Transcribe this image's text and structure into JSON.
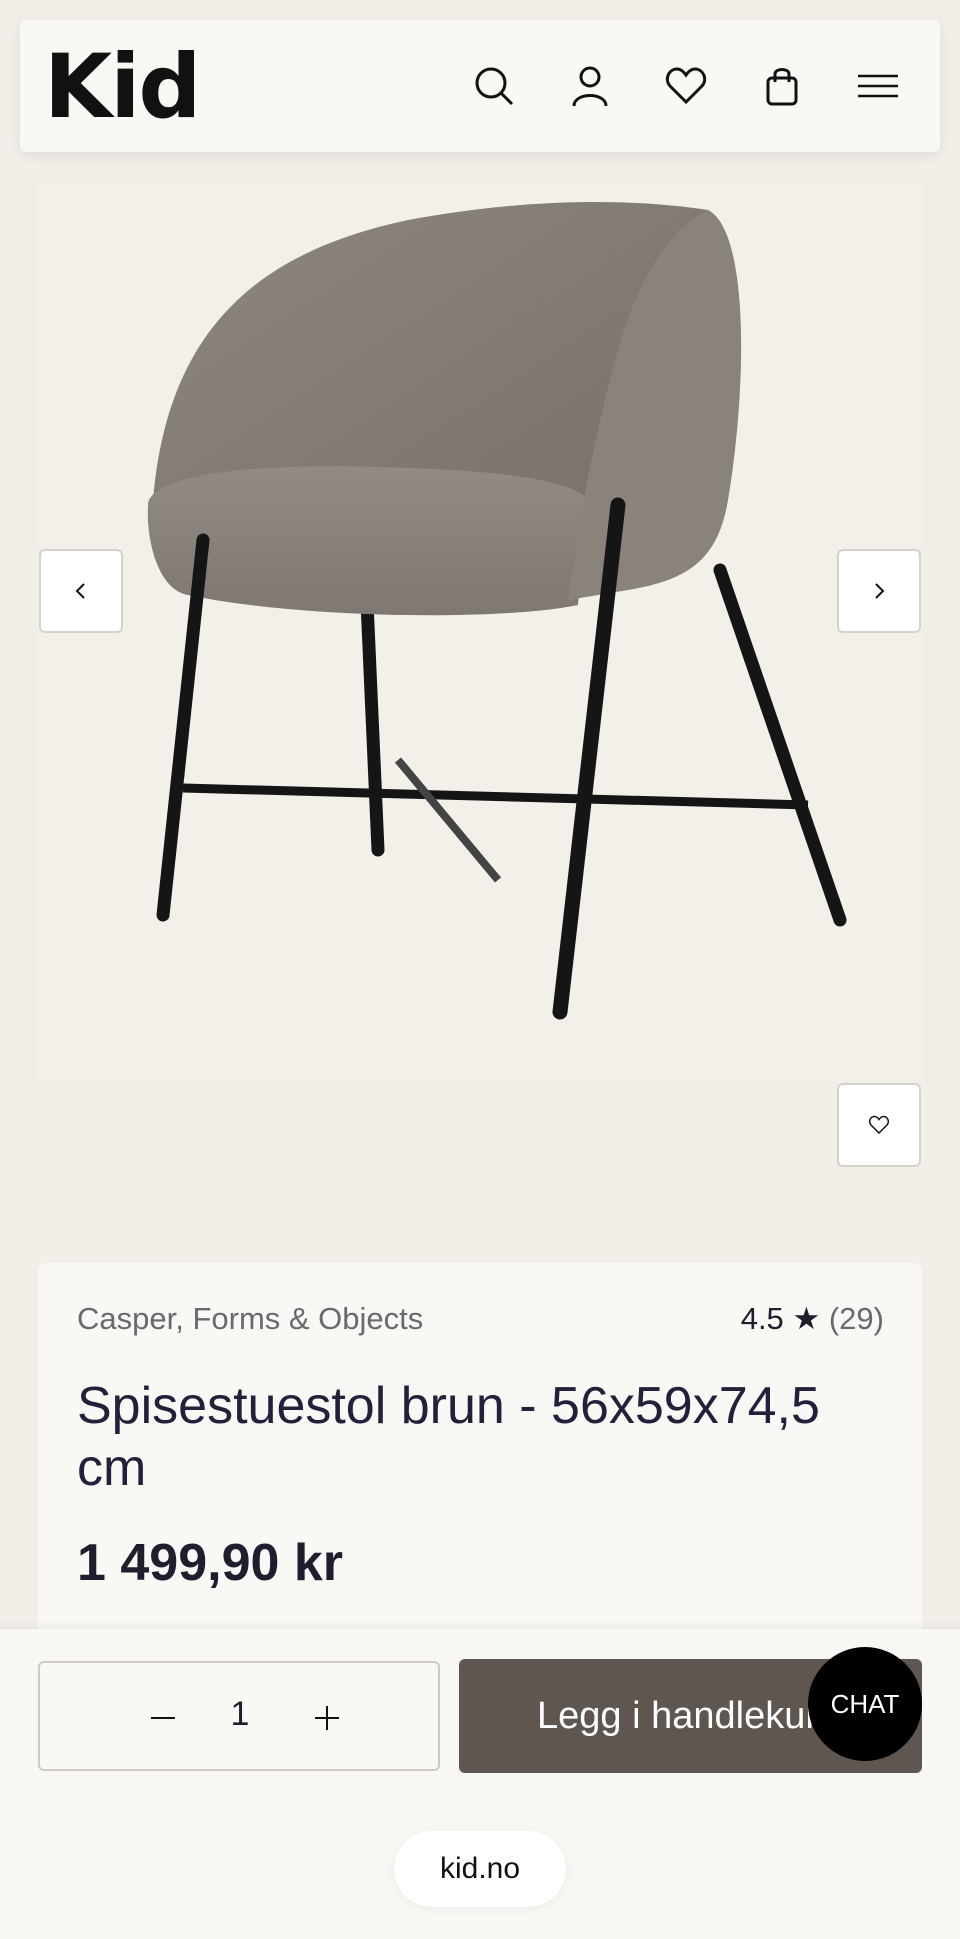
{
  "header": {
    "logo": "Kid",
    "icons": [
      "search-icon",
      "user-icon",
      "heart-icon",
      "bag-icon",
      "menu-icon"
    ]
  },
  "gallery": {
    "image_alt": "Spisestuestol brun",
    "prev_icon": "chevron-left-icon",
    "next_icon": "chevron-right-icon",
    "favorite_icon": "heart-icon"
  },
  "product": {
    "brand": "Casper, Forms & Objects",
    "rating": "4.5",
    "rating_count": "(29)",
    "title": "Spisestuestol brun - 56x59x74,5 cm",
    "price": "1 499,90 kr"
  },
  "purchase": {
    "quantity": "1",
    "add_to_cart_label": "Legg i handlekurv",
    "chat_label": "CHAT"
  },
  "browser": {
    "url": "kid.no"
  },
  "colors": {
    "accent_button": "#5e564f",
    "page_background": "#f2efe9",
    "chat_bubble": "#000000"
  }
}
